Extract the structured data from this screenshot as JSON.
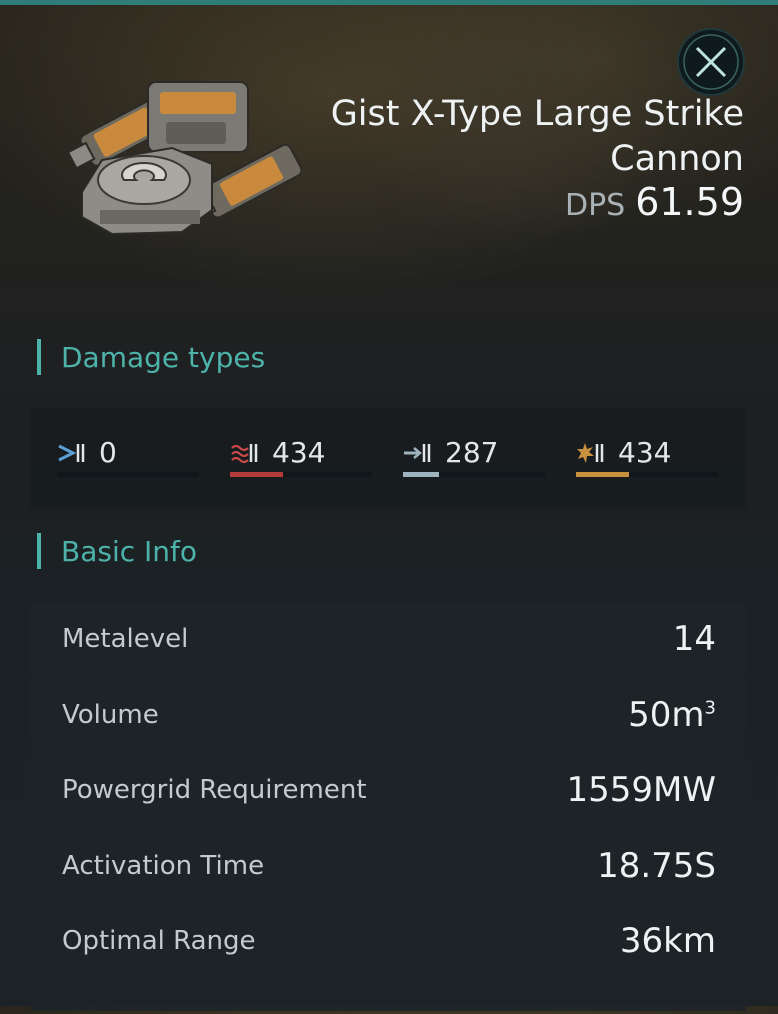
{
  "item": {
    "name": "Gist X-Type Large Strike Cannon",
    "dps_label": "DPS",
    "dps_value": "61.59",
    "image_icon": "strike-cannon-module-image"
  },
  "close_button": {
    "icon": "close-icon"
  },
  "damage_section": {
    "title": "Damage types",
    "items": [
      {
        "icon": "em-damage-icon",
        "value": "0",
        "fill": 0,
        "color": "#5b9fd6"
      },
      {
        "icon": "thermal-damage-icon",
        "value": "434",
        "fill": 0.37,
        "color": "#b53b3b"
      },
      {
        "icon": "kinetic-damage-icon",
        "value": "287",
        "fill": 0.25,
        "color": "#9fb3bf"
      },
      {
        "icon": "explosive-damage-icon",
        "value": "434",
        "fill": 0.37,
        "color": "#c8913e"
      }
    ]
  },
  "basic_info": {
    "title": "Basic Info",
    "rows": [
      {
        "label": "Metalevel",
        "value": "14"
      },
      {
        "label": "Volume",
        "value": "50m",
        "sup": "3"
      },
      {
        "label": "Powergrid Requirement",
        "value": "1559MW"
      },
      {
        "label": "Activation Time",
        "value": "18.75S"
      },
      {
        "label": "Optimal Range",
        "value": "36km"
      }
    ]
  },
  "colors": {
    "accent": "#4db3aa",
    "topbar": "#2f7c78"
  }
}
